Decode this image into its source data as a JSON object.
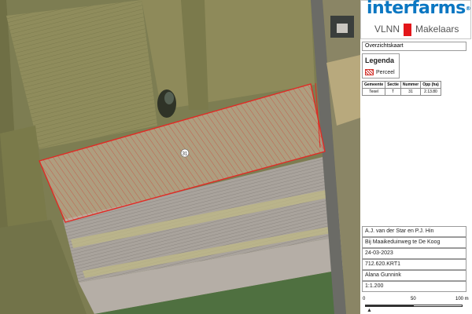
{
  "logo": {
    "brand": "interfarms",
    "registered": "®",
    "left_text": "VLNN",
    "right_text": "Makelaars"
  },
  "overview_title": "Overzichtskaart",
  "legend": {
    "title": "Legenda",
    "item": "Perceel",
    "colors": {
      "parcel_outline": "#d2312b",
      "logo_blue": "#0b77c2",
      "logo_red": "#e3161a"
    }
  },
  "parcel_table": {
    "headers": [
      "Gemeente",
      "Sectie",
      "Nummer",
      "Opp (ha)"
    ],
    "rows": [
      [
        "Texel",
        "T",
        "31",
        "2.13.80"
      ]
    ]
  },
  "parcel_label": "31",
  "info": {
    "owner": "A.J. van der Star en P.J. Hin",
    "location": "Bij Maaikeduinweg te De Koog",
    "date": "24-03-2023",
    "reference": "712.620.KRT1",
    "author": "Alana Gunnink",
    "scale": "1:1.200"
  },
  "scalebar": {
    "ticks": [
      "0",
      "50",
      "100 m"
    ]
  }
}
